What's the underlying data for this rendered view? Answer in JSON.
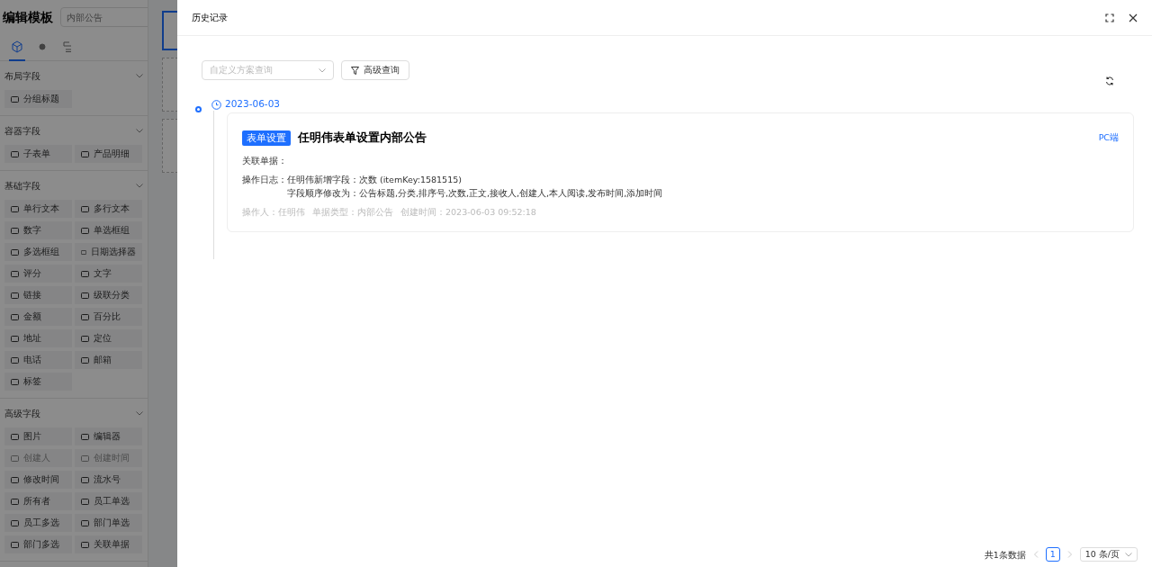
{
  "editor": {
    "title": "编辑模板",
    "name_field": {
      "placeholder": "内部公告"
    },
    "tabs": [
      {
        "selected": true
      },
      {
        "selected": false
      },
      {
        "selected": false
      }
    ]
  },
  "sections": [
    {
      "title": "布局字段",
      "expanded": true,
      "items": [
        {
          "label": "分组标题",
          "disabled": false
        }
      ]
    },
    {
      "title": "容器字段",
      "expanded": true,
      "items": [
        {
          "label": "子表单",
          "disabled": false
        },
        {
          "label": "产品明细",
          "disabled": false
        }
      ]
    },
    {
      "title": "基础字段",
      "expanded": true,
      "items": [
        {
          "label": "单行文本",
          "disabled": false
        },
        {
          "label": "多行文本",
          "disabled": false
        },
        {
          "label": "数字",
          "disabled": false
        },
        {
          "label": "单选框组",
          "disabled": false
        },
        {
          "label": "多选框组",
          "disabled": false
        },
        {
          "label": "日期选择器",
          "disabled": false
        },
        {
          "label": "评分",
          "disabled": false
        },
        {
          "label": "文字",
          "disabled": false
        },
        {
          "label": "链接",
          "disabled": false
        },
        {
          "label": "级联分类",
          "disabled": false
        },
        {
          "label": "金额",
          "disabled": false
        },
        {
          "label": "百分比",
          "disabled": false
        },
        {
          "label": "地址",
          "disabled": false
        },
        {
          "label": "定位",
          "disabled": false
        },
        {
          "label": "电话",
          "disabled": false
        },
        {
          "label": "邮箱",
          "disabled": false
        },
        {
          "label": "标签",
          "disabled": false
        }
      ]
    },
    {
      "title": "高级字段",
      "expanded": true,
      "items": [
        {
          "label": "图片",
          "disabled": false
        },
        {
          "label": "编辑器",
          "disabled": false
        },
        {
          "label": "创建人",
          "disabled": true
        },
        {
          "label": "创建时间",
          "disabled": true
        },
        {
          "label": "修改时间",
          "disabled": false
        },
        {
          "label": "流水号",
          "disabled": false
        },
        {
          "label": "所有者",
          "disabled": false
        },
        {
          "label": "员工单选",
          "disabled": false
        },
        {
          "label": "员工多选",
          "disabled": false
        },
        {
          "label": "部门单选",
          "disabled": false
        },
        {
          "label": "部门多选",
          "disabled": false
        },
        {
          "label": "关联单据",
          "disabled": false
        }
      ]
    }
  ],
  "drawer": {
    "title": "历史记录",
    "scheme_select": {
      "placeholder": "自定义方案查询"
    },
    "advanced_button": "高级查询",
    "timeline": [
      {
        "date": "2023-06-03",
        "records": [
          {
            "tag": "表单设置",
            "title": "任明伟表单设置内部公告",
            "platform": "PC端",
            "related_label": "关联单据：",
            "log_label": "操作日志：",
            "log_lines": [
              "任明伟新增字段：次数 (itemKey:1581515)",
              "字段顺序修改为：公告标题,分类,排序号,次数,正文,接收人,创建人,本人阅读,发布时间,添加时间"
            ],
            "meta": [
              "操作人：任明伟",
              "单据类型：内部公告",
              "创建时间：2023-06-03 09:52:18"
            ]
          }
        ]
      }
    ],
    "pagination": {
      "total": "共1条数据",
      "pages": [
        {
          "label": "1",
          "selected": true
        }
      ],
      "page_size": "10 条/页"
    }
  }
}
